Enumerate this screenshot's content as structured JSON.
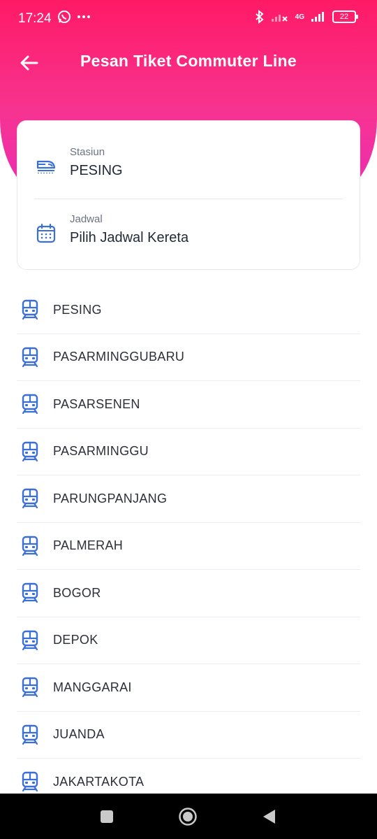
{
  "status_bar": {
    "time": "17:24",
    "battery": "22",
    "network_tag": "4G"
  },
  "appbar": {
    "title": "Pesan Tiket Commuter Line"
  },
  "card": {
    "station": {
      "label": "Stasiun",
      "value": "PESING"
    },
    "schedule": {
      "label": "Jadwal",
      "value": "Pilih Jadwal Kereta"
    }
  },
  "stations": [
    {
      "name": "PESING"
    },
    {
      "name": "PASARMINGGUBARU"
    },
    {
      "name": "PASARSENEN"
    },
    {
      "name": "PASARMINGGU"
    },
    {
      "name": "PARUNGPANJANG"
    },
    {
      "name": "PALMERAH"
    },
    {
      "name": "BOGOR"
    },
    {
      "name": "DEPOK"
    },
    {
      "name": "MANGGARAI"
    },
    {
      "name": "JUANDA"
    },
    {
      "name": "JAKARTAKOTA"
    }
  ],
  "colors": {
    "header_gradient_top": "#ff1a66",
    "header_gradient_bottom": "#ea2fb4",
    "accent_blue": "#3b6fd8"
  },
  "icons": {
    "back": "arrow-left-icon",
    "station": "train-icon",
    "schedule": "calendar-icon",
    "list_item": "train-front-icon"
  }
}
